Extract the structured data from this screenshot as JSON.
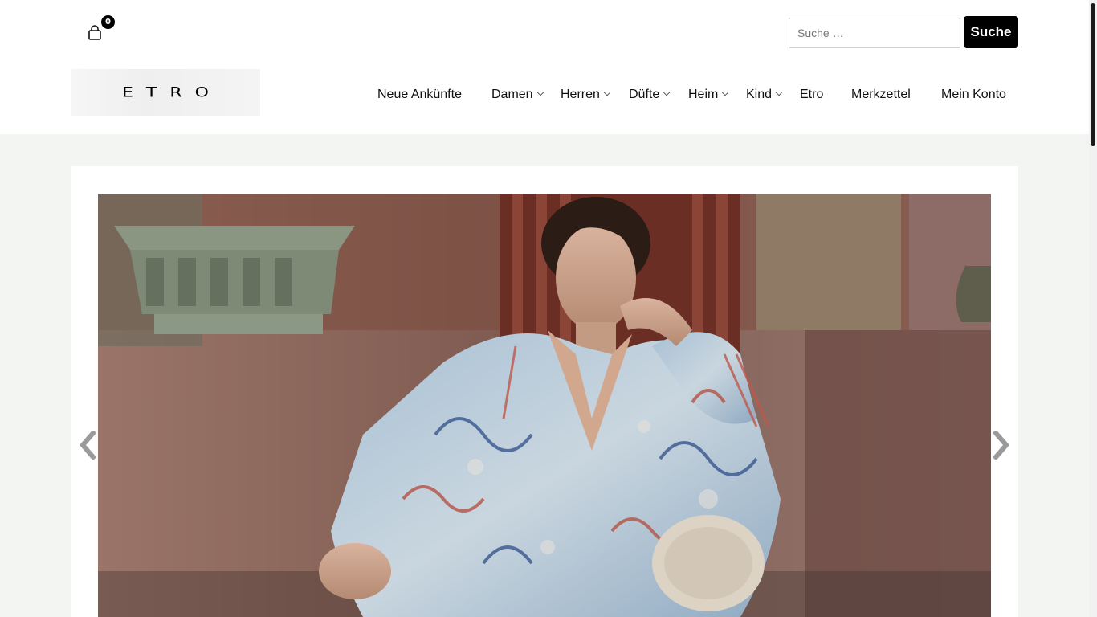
{
  "cart": {
    "count": "0",
    "icon": "shopping-bag-icon"
  },
  "search": {
    "placeholder": "Suche …",
    "button_label": "Suche"
  },
  "brand": {
    "logo_text": "ETRO"
  },
  "nav": {
    "items": [
      {
        "label": "Neue Ankünfte",
        "has_dropdown": false
      },
      {
        "label": "Damen",
        "has_dropdown": true
      },
      {
        "label": "Herren",
        "has_dropdown": true
      },
      {
        "label": "Düfte",
        "has_dropdown": true
      },
      {
        "label": "Heim",
        "has_dropdown": true
      },
      {
        "label": "Kind",
        "has_dropdown": true
      },
      {
        "label": "Etro",
        "has_dropdown": false
      },
      {
        "label": "Merkzettel",
        "has_dropdown": false
      },
      {
        "label": "Mein Konto",
        "has_dropdown": false
      }
    ]
  },
  "slider": {
    "prev_icon": "chevron-left-icon",
    "next_icon": "chevron-right-icon"
  },
  "colors": {
    "header_bg": "#ffffff",
    "page_bg": "#f3f5f3",
    "button_bg": "#000000",
    "wall_red": "#8e5a4e",
    "column_green": "#7f8a78"
  }
}
